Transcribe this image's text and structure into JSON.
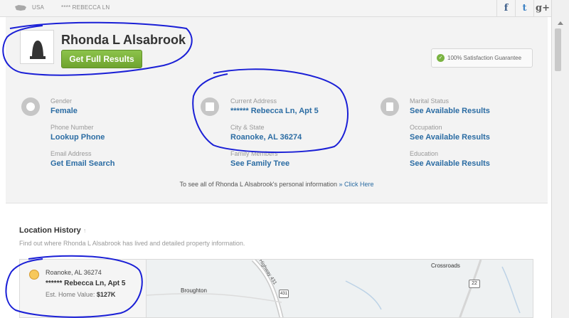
{
  "topbar": {
    "crumbs": [
      "USA",
      "**** REBECCA LN"
    ],
    "social": [
      "f",
      "t",
      "g+"
    ]
  },
  "person": {
    "name": "Rhonda L Alsabrook",
    "cta": "Get Full Results"
  },
  "guarantee": "100% Satisfaction Guarantee",
  "fields": {
    "gender": {
      "label": "Gender",
      "value": "Female"
    },
    "phone": {
      "label": "Phone Number",
      "value": "Lookup Phone"
    },
    "email": {
      "label": "Email Address",
      "value": "Get Email Search"
    },
    "current_address": {
      "label": "Current Address",
      "value": "****** Rebecca Ln, Apt 5"
    },
    "city_state": {
      "label": "City & State",
      "value": "Roanoke, AL 36274"
    },
    "family": {
      "label": "Family Members",
      "value": "See Family Tree"
    },
    "marital": {
      "label": "Marital Status",
      "value": "See Available Results"
    },
    "occupation": {
      "label": "Occupation",
      "value": "See Available Results"
    },
    "education": {
      "label": "Education",
      "value": "See Available Results"
    }
  },
  "see_all": {
    "text": "To see all of Rhonda L Alsabrook's personal information",
    "link": "» Click Here"
  },
  "history": {
    "title": "Location History",
    "arrow": "↑",
    "subtitle": "Find out where Rhonda L Alsabrook has lived and detailed property information."
  },
  "location": {
    "city": "Roanoke, AL 36274",
    "address": "****** Rebecca Ln, Apt 5",
    "value_label": "Est. Home Value:",
    "value": "$127K"
  },
  "map": {
    "labels": [
      "Crossroads",
      "Broughton",
      "Highway 431",
      "22",
      "431"
    ]
  },
  "colors": {
    "link": "#2b6ca3",
    "button_green": "#7ab341",
    "annotation_ink": "#1a1fd6"
  }
}
